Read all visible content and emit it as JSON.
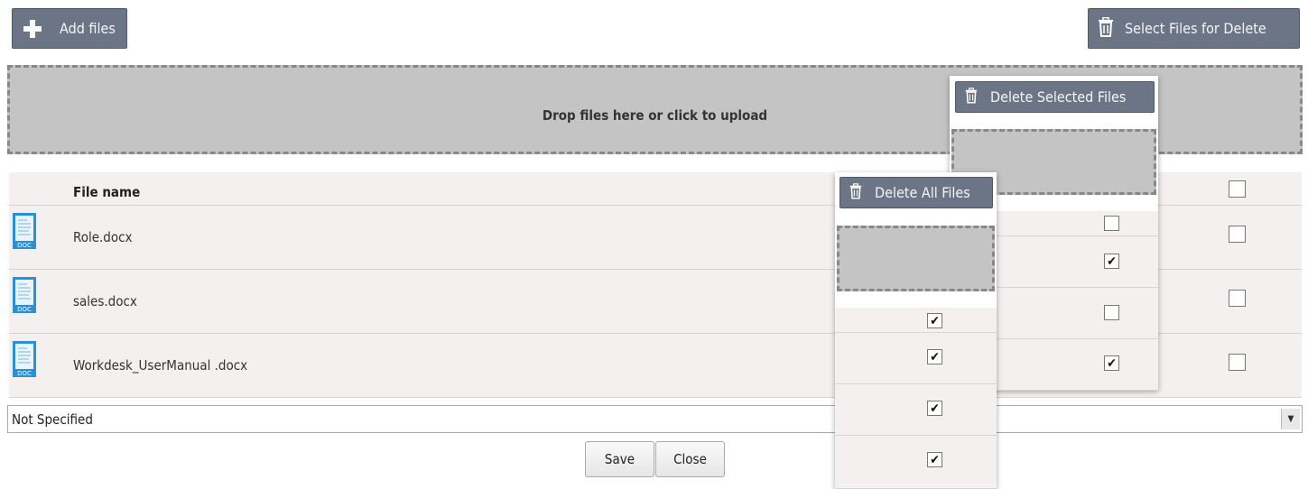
{
  "toolbar": {
    "add_files_label": "Add files",
    "select_delete_label": "Select Files for Delete"
  },
  "dropzone": {
    "text": "Drop files here or click to upload"
  },
  "table": {
    "header": "File name",
    "files": [
      {
        "name": "Role.docx",
        "icon": "doc-file-icon",
        "badge": "DOC"
      },
      {
        "name": "sales.docx",
        "icon": "doc-file-icon",
        "badge": "DOC"
      },
      {
        "name": "Workdesk_UserManual .docx",
        "icon": "doc-file-icon",
        "badge": "DOC"
      }
    ]
  },
  "category_select": {
    "value": "Not Specified"
  },
  "actions": {
    "save_label": "Save",
    "close_label": "Close"
  },
  "delete_selected_panel": {
    "button_label": "Delete Selected Files",
    "checks": [
      false,
      true,
      false,
      true
    ]
  },
  "delete_all_panel": {
    "button_label": "Delete All Files",
    "checks": [
      true,
      true,
      true,
      true
    ]
  },
  "main_checks": {
    "header": false,
    "rows": [
      false,
      false,
      false
    ]
  },
  "colors": {
    "button_bg": "#6b7585",
    "dropzone_bg": "#c4c4c4",
    "row_bg": "#f4f0ef",
    "doc_icon_blue": "#2b8fd6"
  }
}
